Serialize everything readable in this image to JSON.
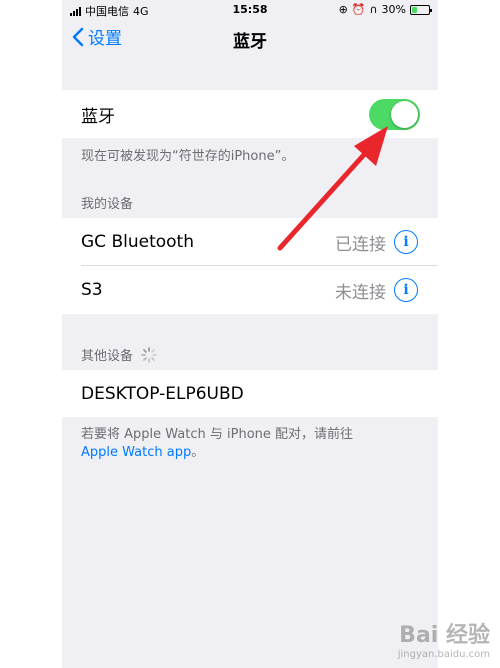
{
  "status_bar": {
    "carrier": "中国电信",
    "network": "4G",
    "time": "15:58",
    "battery": "30%",
    "battery_level": 0.3
  },
  "nav": {
    "back_label": "设置",
    "title": "蓝牙"
  },
  "bluetooth": {
    "label": "蓝牙",
    "enabled": true,
    "discoverable_note": "现在可被发现为“符世存的iPhone”。"
  },
  "my_devices": {
    "header": "我的设备",
    "items": [
      {
        "name": "GC Bluetooth",
        "status": "已连接"
      },
      {
        "name": "S3",
        "status": "未连接"
      }
    ]
  },
  "other_devices": {
    "header": "其他设备",
    "items": [
      {
        "name": "DESKTOP-ELP6UBD"
      }
    ]
  },
  "footer": {
    "text": "若要将 Apple Watch 与 iPhone 配对，请前往",
    "link": "Apple Watch app",
    "suffix": "。"
  },
  "watermark": {
    "main": "Bai 经验",
    "sub": "jingyan.baidu.com"
  },
  "colors": {
    "accent": "#007aff",
    "toggle_on": "#4cd964",
    "annotation_arrow": "#e8262b"
  }
}
